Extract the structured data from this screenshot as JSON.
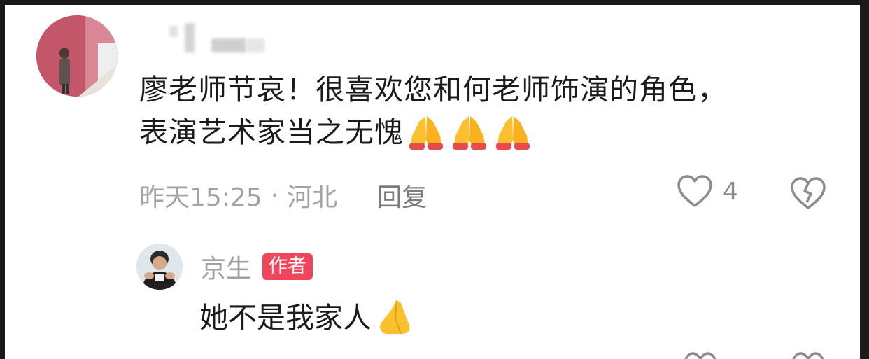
{
  "comment": {
    "line1": "廖老师节哀！很喜欢您和何老师饰演的角色，",
    "line2": "表演艺术家当之无愧",
    "emojis": [
      "folded-hands-icon",
      "folded-hands-icon",
      "folded-hands-icon"
    ],
    "time": "昨天15:25",
    "separator": "·",
    "location": "河北",
    "reply_label": "回复",
    "like_count": "4"
  },
  "reply": {
    "author": "京生",
    "badge": "作者",
    "text": "她不是我家人",
    "emoji": "folded-hands-icon"
  },
  "colors": {
    "badge": "#f0455a",
    "meta_text": "#a3a3a3",
    "body_text": "#1b1b1b"
  }
}
